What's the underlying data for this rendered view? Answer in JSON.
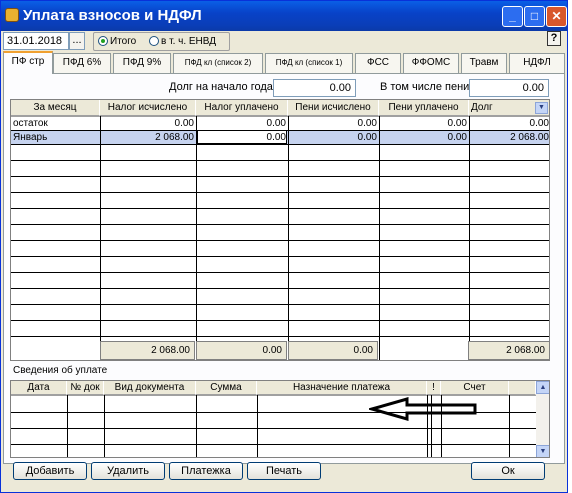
{
  "window": {
    "title": "Уплата взносов и НДФЛ",
    "minimize": "_",
    "maximize": "□",
    "close": "✕"
  },
  "toolbar": {
    "date": "31.01.2018",
    "dots": "...",
    "help": "?",
    "radio_total": "Итого",
    "radio_envd": "в т. ч. ЕНВД",
    "selected_radio": "total"
  },
  "tabs": [
    "ПФ стр",
    "ПФД 6%",
    "ПФД 9%",
    "ПФД кл (список 2)",
    "ПФД кл (список 1)",
    "ФСС",
    "ФФОМС",
    "Травм",
    "НДФЛ"
  ],
  "active_tab": "ПФ стр",
  "top_fields": {
    "debt_start_label": "Долг на начало года",
    "debt_start_value": "0.00",
    "penalty_label": "В том числе пени",
    "penalty_value": "0.00"
  },
  "main_table": {
    "columns": [
      "За месяц",
      "Налог исчислено",
      "Налог уплачено",
      "Пени исчислено",
      "Пени уплачено",
      "Долг"
    ],
    "rows": [
      [
        "остаток",
        "0.00",
        "0.00",
        "0.00",
        "0.00",
        "0.00"
      ],
      [
        "Январь",
        "2 068.00",
        "0.00",
        "0.00",
        "0.00",
        "2 068.00"
      ]
    ],
    "totals": [
      "2 068.00",
      "0.00",
      "0.00",
      "2 068.00"
    ]
  },
  "payments": {
    "section_label": "Сведения об уплате",
    "columns": [
      "Дата",
      "№ док",
      "Вид документа",
      "Сумма",
      "Назначение платежа",
      "!",
      "Счет"
    ]
  },
  "buttons": {
    "add": "Добавить",
    "delete": "Удалить",
    "payment": "Платежка",
    "print": "Печать",
    "ok": "Ок"
  }
}
